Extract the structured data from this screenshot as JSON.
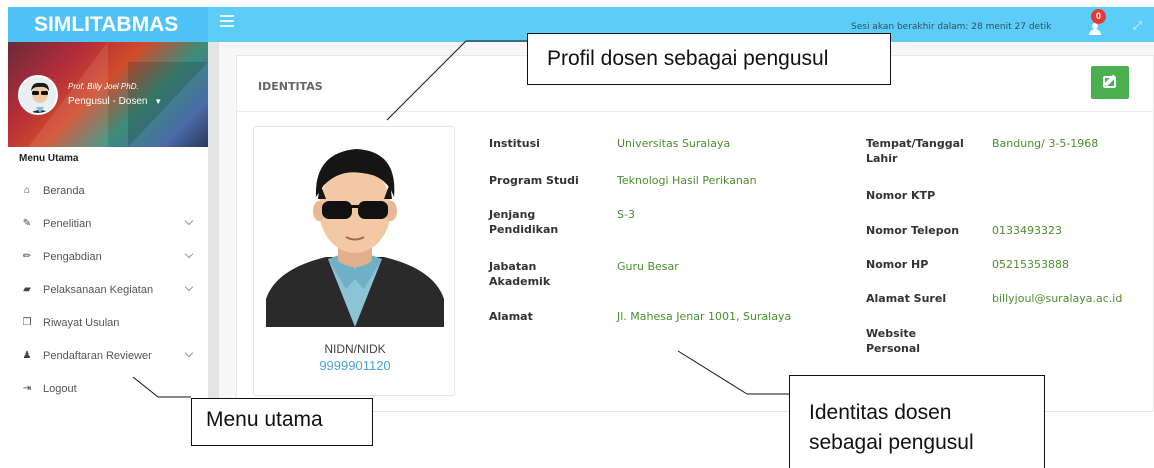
{
  "app": {
    "brand": "SIMLITABMAS"
  },
  "topbar": {
    "menu_icon": "hamburger-icon",
    "session_text": "Sesi akan berakhir dalam: 28 menit 27 detik",
    "notification_count": "0",
    "notification_icon": "user-add-icon",
    "fullscreen_icon": "expand-icon"
  },
  "sidebar": {
    "profile_name": "Prof. Billy Joel PhD.",
    "profile_role": "Pengusul - Dosen",
    "menu_title": "Menu Utama",
    "items": [
      {
        "label": "Beranda",
        "icon": "home-icon",
        "has_submenu": false
      },
      {
        "label": "Penelitian",
        "icon": "edit-icon",
        "has_submenu": true
      },
      {
        "label": "Pengabdian",
        "icon": "pencil-icon",
        "has_submenu": true
      },
      {
        "label": "Pelaksanaan Kegiatan",
        "icon": "book-icon",
        "has_submenu": true
      },
      {
        "label": "Riwayat Usulan",
        "icon": "copy-icon",
        "has_submenu": false
      },
      {
        "label": "Pendaftaran Reviewer",
        "icon": "user-icon",
        "has_submenu": true
      },
      {
        "label": "Logout",
        "icon": "logout-icon",
        "has_submenu": false
      }
    ]
  },
  "identity": {
    "title": "IDENTITAS",
    "nidn_label": "NIDN/NIDK",
    "nidn_value": "9999901120",
    "left_fields": [
      {
        "label": "Institusi",
        "value": "Universitas Suralaya"
      },
      {
        "label": "Program Studi",
        "value": "Teknologi Hasil Perikanan"
      },
      {
        "label": "Jenjang Pendidikan",
        "value": "S-3"
      },
      {
        "label": "Jabatan Akademik",
        "value": "Guru Besar"
      },
      {
        "label": "Alamat",
        "value": "Jl. Mahesa Jenar 1001, Suralaya"
      }
    ],
    "right_fields": [
      {
        "label": "Tempat/Tanggal Lahir",
        "value": "Bandung/ 3-5-1968"
      },
      {
        "label": "Nomor KTP",
        "value": ""
      },
      {
        "label": "Nomor Telepon",
        "value": "0133493323"
      },
      {
        "label": "Nomor HP",
        "value": "05215353888"
      },
      {
        "label": "Alamat Surel",
        "value": "billyjoul@suralaya.ac.id"
      },
      {
        "label": "Website Personal",
        "value": ""
      }
    ]
  },
  "annotations": {
    "profile_callout": "Profil dosen sebagai pengusul",
    "menu_callout": "Menu utama",
    "identity_callout_line1": "Identitas dosen",
    "identity_callout_line2": "sebagai pengusul"
  },
  "colors": {
    "header": "#5ccdf9",
    "accent_link": "#4aa3d8",
    "value_green": "#4b8f2e",
    "edit_button": "#4caf50",
    "badge": "#e53935"
  }
}
